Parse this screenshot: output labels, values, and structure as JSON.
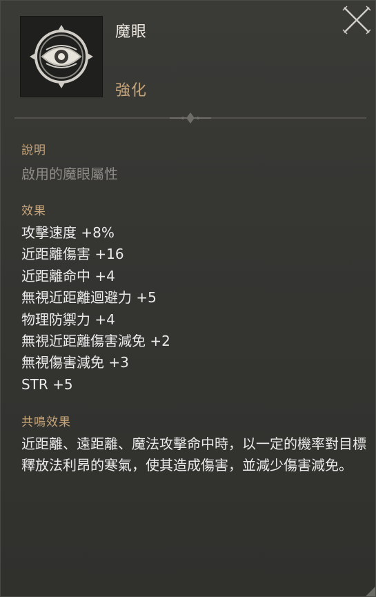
{
  "item": {
    "name": "魔眼",
    "type": "強化",
    "icon": "eye-icon"
  },
  "close": {
    "icon": "close-icon"
  },
  "description": {
    "title": "說明",
    "text": "啟用的魔眼屬性"
  },
  "effects": {
    "title": "效果",
    "items": [
      "攻擊速度 +8%",
      "近距離傷害 +16",
      "近距離命中 +4",
      "無視近距離迴避力 +5",
      "物理防禦力 +4",
      "無視近距離傷害減免 +2",
      "無視傷害減免 +3",
      "STR +5"
    ]
  },
  "resonance": {
    "title": "共鳴效果",
    "text": "近距離、遠距離、魔法攻擊命中時，以一定的機率對目標釋放法利昂的寒氣，使其造成傷害，並減少傷害減免。"
  },
  "colors": {
    "accent": "#c5a47a",
    "text": "#ebebeb",
    "muted": "#8e8c88",
    "panel": "#353532"
  }
}
